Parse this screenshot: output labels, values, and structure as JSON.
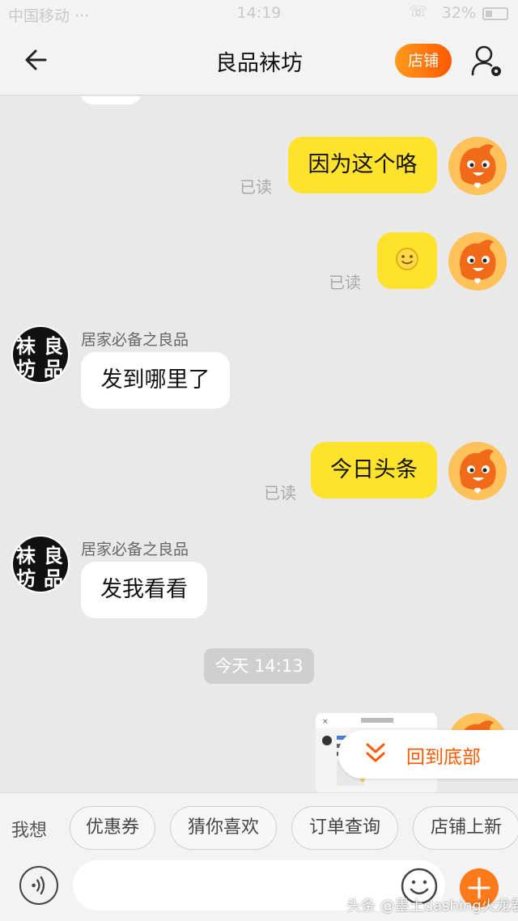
{
  "status_bar": {
    "carrier": "中国移动 ···",
    "time": "14:19",
    "battery": "32%"
  },
  "header": {
    "title": "良品袜坊",
    "shop_button": "店铺"
  },
  "messages": [
    {
      "side": "out",
      "text": "因为这个咯",
      "read": "已读"
    },
    {
      "side": "out",
      "type": "emoji",
      "emoji": "smile",
      "read": "已读"
    },
    {
      "side": "in",
      "sender": "居家必备之良品",
      "text": "发到哪里了"
    },
    {
      "side": "out",
      "text": "今日头条",
      "read": "已读"
    },
    {
      "side": "in",
      "sender": "居家必备之良品",
      "text": "发我看看"
    }
  ],
  "timestamp": "今天 14:13",
  "shop_avatar_text": "袜良坊品",
  "back_to_bottom": "回到底部",
  "quick_bar": {
    "want_label": "我想",
    "chips": [
      "优惠券",
      "猜你喜欢",
      "订单查询",
      "店铺上新"
    ]
  },
  "input": {
    "placeholder": ""
  },
  "watermark": "头条 @墨土dashing火龙君",
  "colors": {
    "accent": "#ff6a00",
    "bubble_out": "#ffe22b",
    "bubble_in": "#ffffff",
    "background": "#e9e9e9"
  }
}
